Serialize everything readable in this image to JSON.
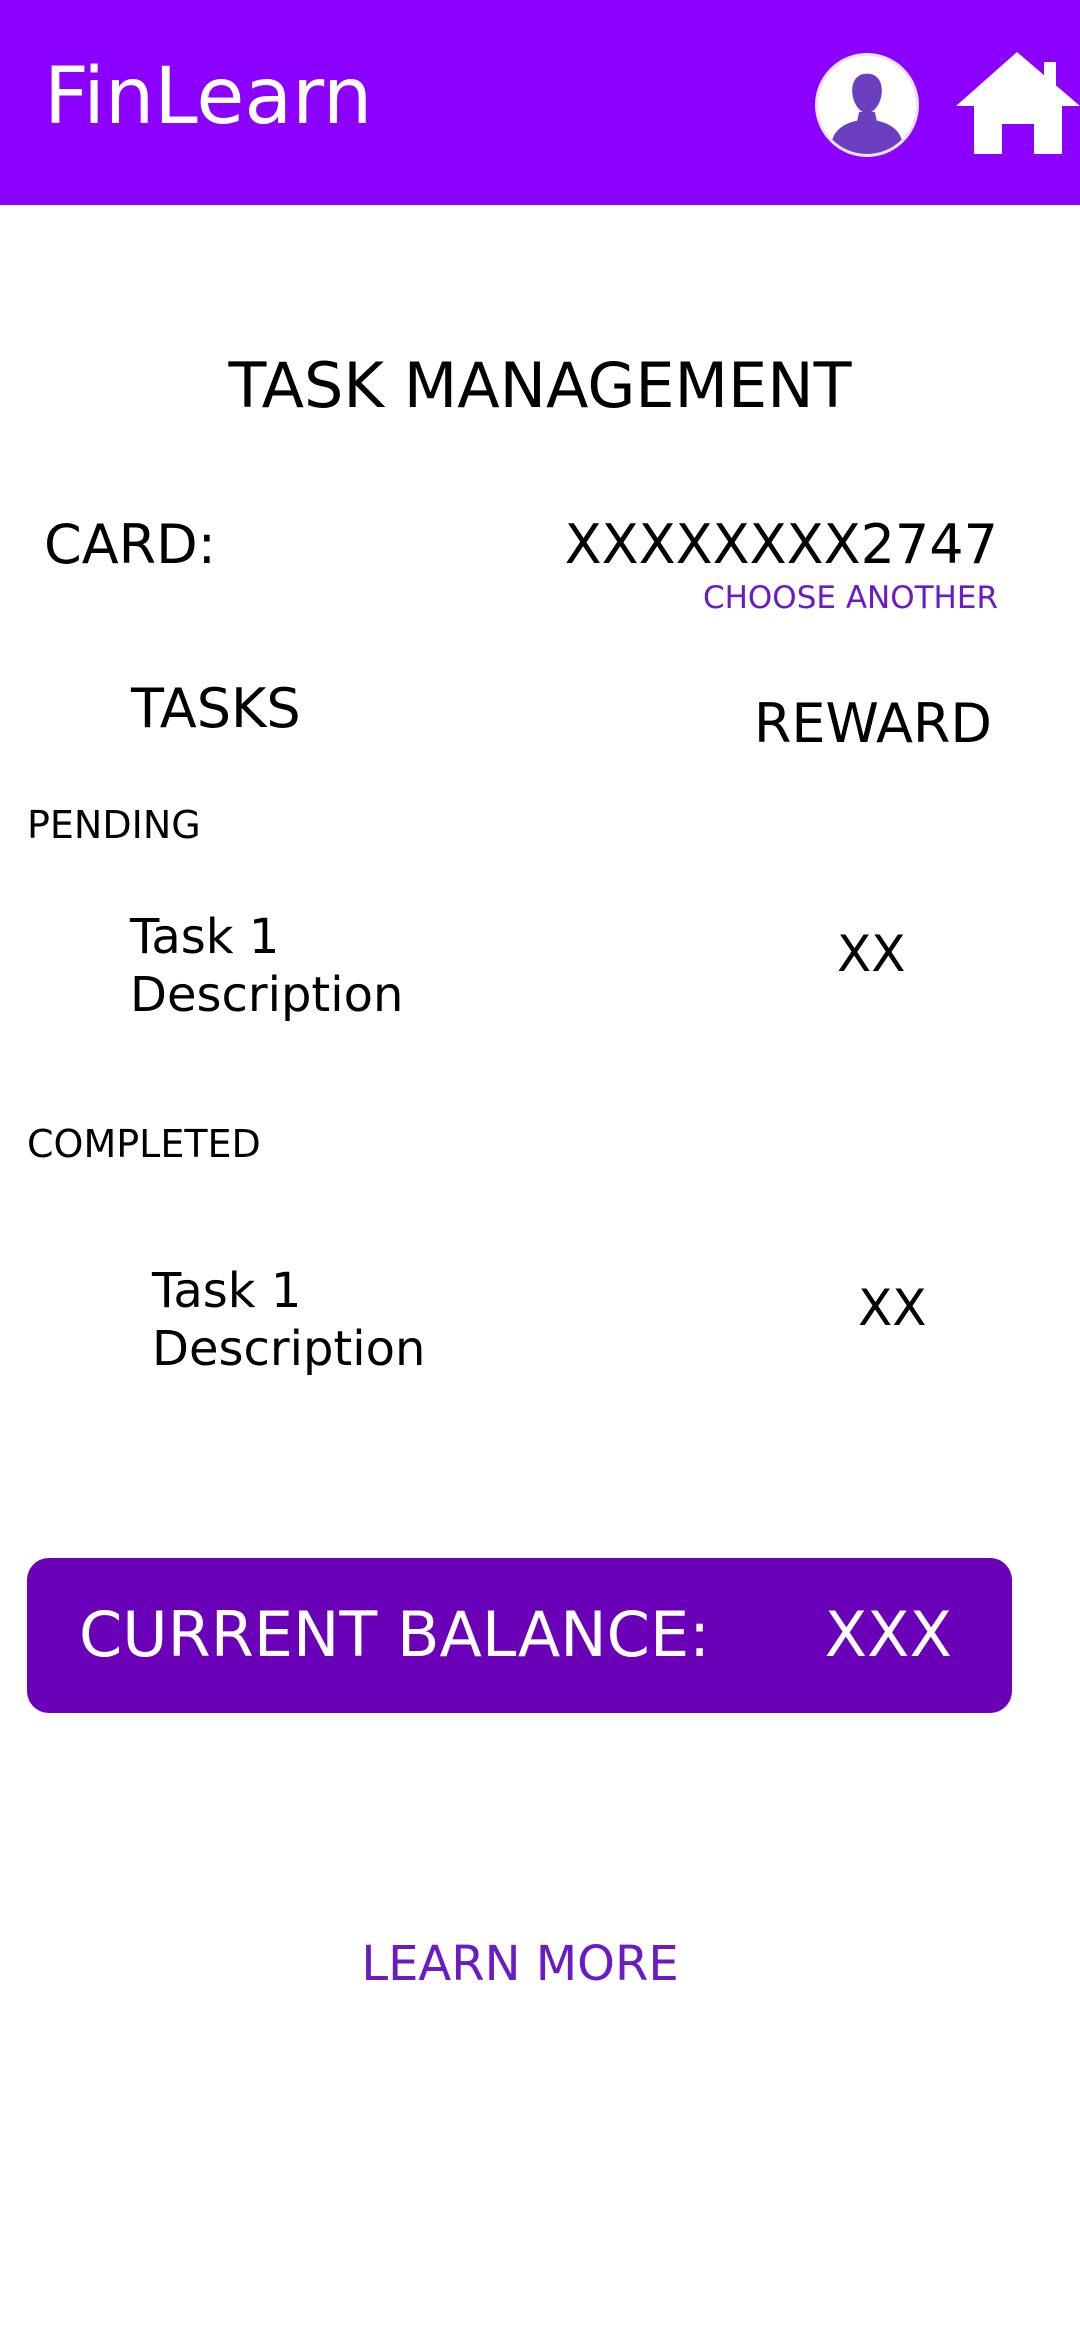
{
  "app": {
    "title": "FinLearn",
    "accent_color": "#8c00ff",
    "profile_icon": "user-avatar-icon",
    "home_icon": "home-icon"
  },
  "page": {
    "title": "TASK MANAGEMENT"
  },
  "card": {
    "label": "CARD:",
    "number": "XXXXXXXX2747",
    "choose_another": "CHOOSE ANOTHER"
  },
  "columns": {
    "tasks": "TASKS",
    "reward": "REWARD"
  },
  "pending": {
    "label": "PENDING",
    "tasks": [
      {
        "description": "Task 1 Description",
        "reward": "XX"
      }
    ]
  },
  "completed": {
    "label": "COMPLETED",
    "tasks": [
      {
        "description": "Task 1 Description",
        "reward": "XX"
      }
    ]
  },
  "balance": {
    "label": "CURRENT BALANCE:",
    "value": "XXX",
    "color": "#6a00b8"
  },
  "footer": {
    "learn_more": "LEARN MORE"
  }
}
